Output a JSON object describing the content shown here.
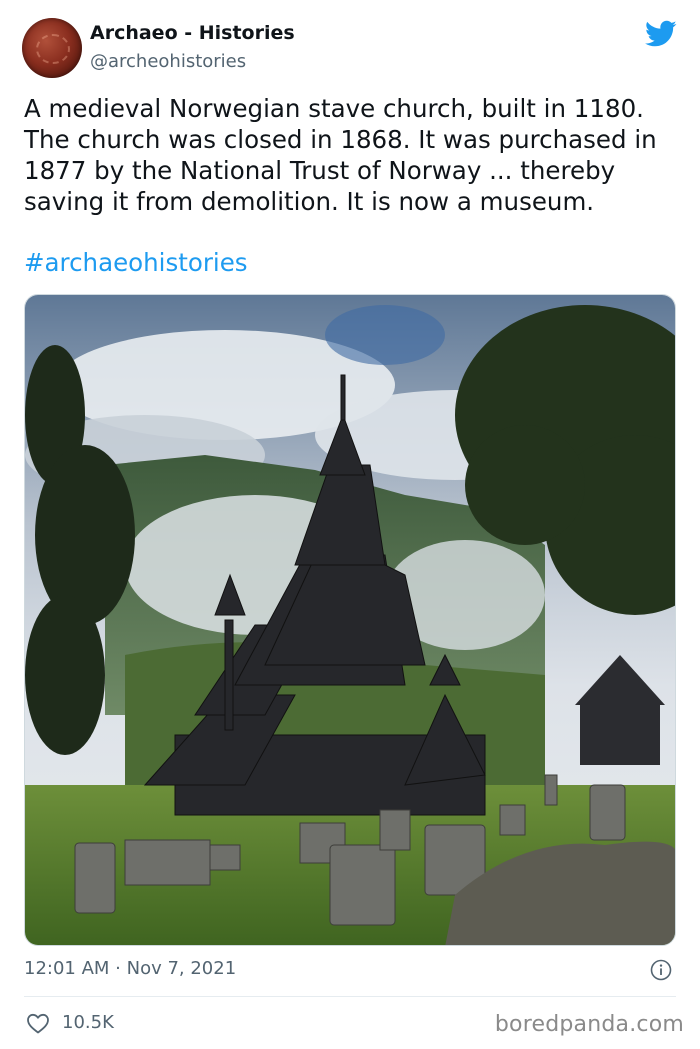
{
  "author": {
    "display_name": "Archaeo - Histories",
    "handle": "@archeohistories",
    "avatar_icon": "avatar-image"
  },
  "tweet": {
    "text": "A medieval Norwegian stave church, built in 1180. The church was closed in 1868. It was purchased in 1877 by the National Trust of Norway ... thereby saving it from demolition. It is now a museum.",
    "hashtag": "#archaeohistories",
    "timestamp": "12:01 AM · Nov 7, 2021"
  },
  "metrics": {
    "likes": "10.5K"
  },
  "watermark": "boredpanda.com",
  "icons": {
    "brand": "twitter-bird-icon",
    "info": "info-icon",
    "like": "heart-icon"
  },
  "colors": {
    "link": "#1d9bf0",
    "secondary_text": "#536471",
    "primary_text": "#0f1419"
  }
}
